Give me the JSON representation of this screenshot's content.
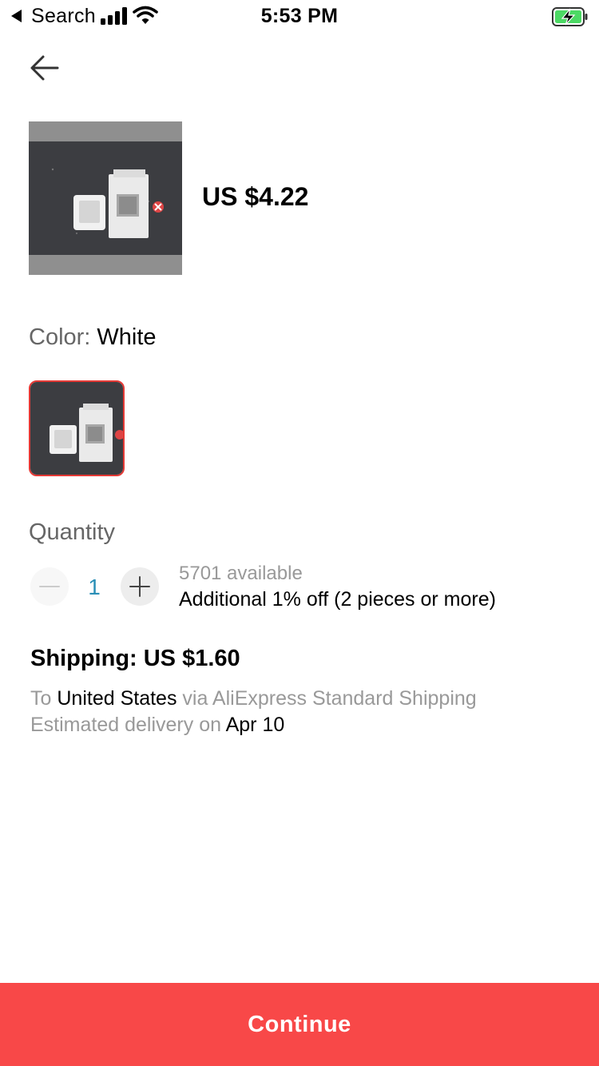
{
  "status_bar": {
    "back_app_label": "Search",
    "time": "5:53 PM",
    "icons": [
      "back-triangle-icon",
      "signal-icon",
      "wifi-icon",
      "battery-charging-icon"
    ],
    "battery_color": "#4cd964"
  },
  "header": {
    "back_icon": "arrow-left-icon"
  },
  "product": {
    "price": "US $4.22",
    "image_icon": "product-thumbnail"
  },
  "color": {
    "label": "Color:",
    "value": "White",
    "swatch_border_color": "#e53935"
  },
  "quantity": {
    "label": "Quantity",
    "value": "1",
    "available": "5701 available",
    "discount": "Additional 1% off (2 pieces or more)",
    "minus_icon": "minus-icon",
    "plus_icon": "plus-icon"
  },
  "shipping": {
    "title": "Shipping: US $1.60",
    "to_prefix": "To",
    "destination": "United States",
    "via_text": "via AliExpress Standard Shipping",
    "delivery_prefix": "Estimated delivery on",
    "delivery_date": "Apr 10"
  },
  "footer": {
    "continue_label": "Continue",
    "continue_color": "#f84848"
  }
}
